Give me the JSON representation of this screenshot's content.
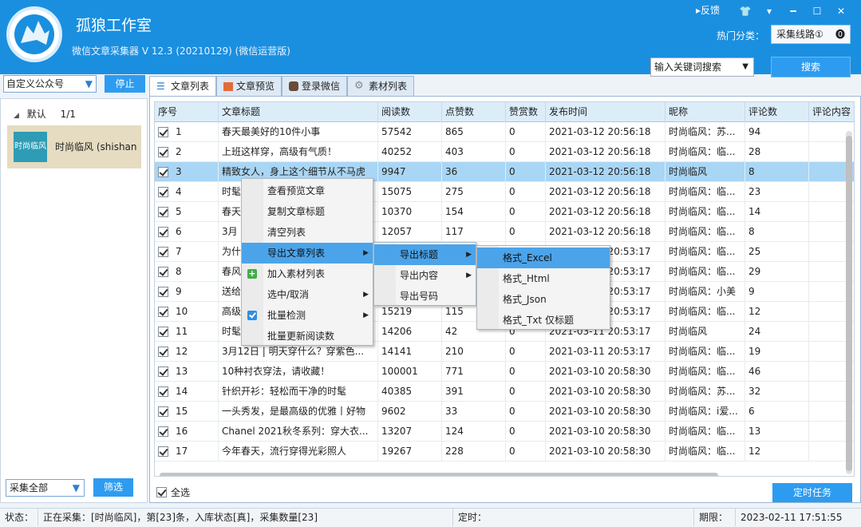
{
  "app": {
    "title": "孤狼工作室",
    "subtitle": "微信文章采集器  V 12.3 (20210129) (微信运营版)",
    "feedback": "反馈",
    "hot_label": "热门分类：",
    "hot_value": "采集线路①",
    "keyword_select": "输入关键词搜索",
    "search_button": "搜索"
  },
  "left": {
    "account_select": "自定义公众号",
    "stop_button": "停止",
    "group_name": "默认",
    "group_count": "1/1",
    "account_name": "时尚临风 (shishan",
    "account_avatar_text": "时尚临风",
    "collect_select": "采集全部",
    "filter_button": "筛选"
  },
  "tabs": [
    {
      "label": "文章列表"
    },
    {
      "label": "文章预览"
    },
    {
      "label": "登录微信"
    },
    {
      "label": "素材列表"
    }
  ],
  "grid": {
    "headers": [
      "序号",
      "文章标题",
      "阅读数",
      "点赞数",
      "赞赏数",
      "发布时间",
      "昵称",
      "评论数",
      "评论内容"
    ],
    "rows": [
      [
        "1",
        "春天最美好的10件小事",
        "57542",
        "865",
        "0",
        "2021-03-12 20:56:18",
        "时尚临风：苏...",
        "94"
      ],
      [
        "2",
        "上班这样穿，高级有气质！",
        "40252",
        "403",
        "0",
        "2021-03-12 20:56:18",
        "时尚临风：临...",
        "28"
      ],
      [
        "3",
        "精致女人，身上这个细节从不马虎",
        "9947",
        "36",
        "0",
        "2021-03-12 20:56:18",
        "时尚临风",
        "8"
      ],
      [
        "4",
        "时髦又有范，这件单品完胜了一...",
        "15075",
        "275",
        "0",
        "2021-03-12 20:56:18",
        "时尚临风：临...",
        "23"
      ],
      [
        "5",
        "春天来了，这么穿最好看",
        "10370",
        "154",
        "0",
        "2021-03-12 20:56:18",
        "时尚临风：临...",
        "14"
      ],
      [
        "6",
        "3月",
        "12057",
        "117",
        "0",
        "2021-03-12 20:56:18",
        "时尚临风：临...",
        "8"
      ],
      [
        "7",
        "为什",
        "",
        "",
        "0",
        "2021-03-11 20:53:17",
        "时尚临风：临...",
        "25"
      ],
      [
        "8",
        "春风",
        "",
        "",
        "0",
        "2021-03-11 20:53:17",
        "时尚临风：临...",
        "29"
      ],
      [
        "9",
        "送给",
        "",
        "208",
        "0",
        "2021-03-11 20:53:17",
        "时尚临风：小美",
        "9"
      ],
      [
        "10",
        "高级",
        "15219",
        "115",
        "0",
        "2021-03-11 20:53:17",
        "时尚临风：临...",
        "12"
      ],
      [
        "11",
        "时髦",
        "14206",
        "42",
        "0",
        "2021-03-11 20:53:17",
        "时尚临风",
        "24"
      ],
      [
        "12",
        "3月12日 | 明天穿什么？穿紫色...",
        "14141",
        "210",
        "0",
        "2021-03-11 20:53:17",
        "时尚临风：临...",
        "19"
      ],
      [
        "13",
        "10种衬衣穿法，请收藏！",
        "100001",
        "771",
        "0",
        "2021-03-10 20:58:30",
        "时尚临风：临...",
        "46"
      ],
      [
        "14",
        "针织开衫：轻松而干净的时髦",
        "40385",
        "391",
        "0",
        "2021-03-10 20:58:30",
        "时尚临风：苏...",
        "32"
      ],
      [
        "15",
        "一头秀发，是最高级的优雅丨好物",
        "9602",
        "33",
        "0",
        "2021-03-10 20:58:30",
        "时尚临风：i爱...",
        "6"
      ],
      [
        "16",
        "Chanel 2021秋冬系列：穿大衣...",
        "13207",
        "124",
        "0",
        "2021-03-10 20:58:30",
        "时尚临风：临...",
        "13"
      ],
      [
        "17",
        "今年春天，流行穿得光彩照人",
        "19267",
        "228",
        "0",
        "2021-03-10 20:58:30",
        "时尚临风：临...",
        "12"
      ]
    ],
    "select_all": "全选",
    "timer_button": "定时任务"
  },
  "context_menu": {
    "items": [
      "查看预览文章",
      "复制文章标题",
      "清空列表",
      "导出文章列表",
      "加入素材列表",
      "选中/取消",
      "批量检测",
      "批量更新阅读数"
    ],
    "export_submenu": [
      "导出标题",
      "导出内容",
      "导出号码"
    ],
    "format_submenu": [
      "格式_Excel",
      "格式_Html",
      "格式_Json",
      "格式_Txt 仅标题"
    ]
  },
  "status": {
    "label": "状态：",
    "text": "正在采集：[时尚临风]，第[23]条，入库状态[真]，采集数量[23]",
    "timer_label": "定时：",
    "expire_label": "期限：",
    "expire_value": "2023-02-11 17:51:55"
  },
  "colors": {
    "titlebar": "#1a8fe0",
    "accent": "#2d9cf0",
    "selected_row": "#a9d6f5",
    "menu_highlight": "#4ba4ea"
  }
}
